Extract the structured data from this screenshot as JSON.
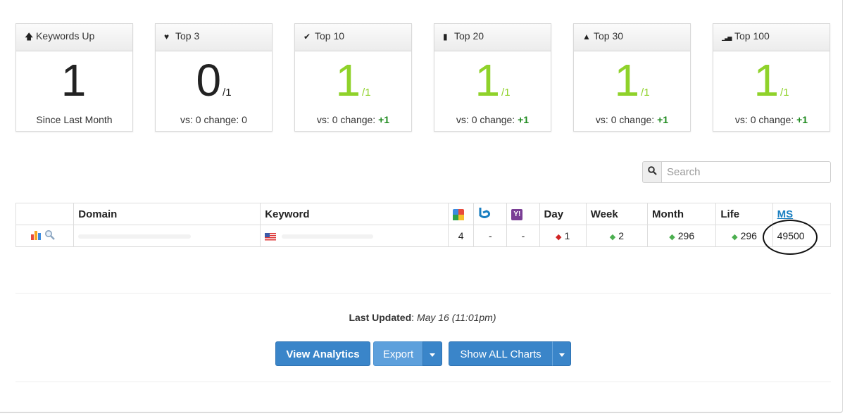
{
  "stats": [
    {
      "icon": "arrow-up-icon",
      "glyph": "🡅",
      "label": "Keywords Up",
      "value": "1",
      "denom": "",
      "footer_prefix": "Since Last Month",
      "footer_change": ""
    },
    {
      "icon": "heart-icon",
      "glyph": "♥",
      "label": "Top 3",
      "value": "0",
      "denom": "/1",
      "footer_prefix": "vs: 0 change: 0",
      "footer_change": ""
    },
    {
      "icon": "check-icon",
      "glyph": "✔",
      "label": "Top 10",
      "value": "1",
      "denom": "/1",
      "footer_prefix": "vs: 0 change: ",
      "footer_change": "+1"
    },
    {
      "icon": "bookmark-icon",
      "glyph": "▮",
      "label": "Top 20",
      "value": "1",
      "denom": "/1",
      "footer_prefix": "vs: 0 change: ",
      "footer_change": "+1"
    },
    {
      "icon": "road-icon",
      "glyph": "▲",
      "label": "Top 30",
      "value": "1",
      "denom": "/1",
      "footer_prefix": "vs: 0 change: ",
      "footer_change": "+1"
    },
    {
      "icon": "signal-icon",
      "glyph": "▁▃▅",
      "label": "Top 100",
      "value": "1",
      "denom": "/1",
      "footer_prefix": "vs: 0 change: ",
      "footer_change": "+1"
    }
  ],
  "search": {
    "placeholder": "Search"
  },
  "table": {
    "headers": {
      "domain": "Domain",
      "keyword": "Keyword",
      "day": "Day",
      "week": "Week",
      "month": "Month",
      "life": "Life",
      "ms": "MS"
    },
    "row": {
      "google": "4",
      "bing": "-",
      "yahoo": "-",
      "day": "1",
      "week": "2",
      "month": "296",
      "life": "296",
      "ms": "49500"
    }
  },
  "last_updated": {
    "label": "Last Updated",
    "value": "May 16 (11:01pm)"
  },
  "buttons": {
    "analytics": "View Analytics",
    "export": "Export",
    "charts": "Show ALL Charts"
  },
  "colors": {
    "accent": "#3a85c9",
    "green": "#8fd22a",
    "positive": "#1e8a1e"
  }
}
